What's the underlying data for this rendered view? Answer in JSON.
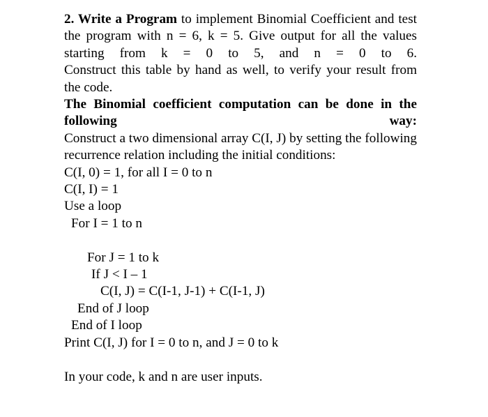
{
  "document": {
    "question_number": "2.",
    "paragraphs": [
      {
        "id": "p1",
        "bold_lead": "2. Write a Program",
        "rest": " to implement Binomial Coefficient and test the program with n = 6, k = 5. Give output for all the values starting from k = 0 to 5, and n = 0 to 6."
      },
      {
        "id": "p2",
        "text": "Construct this table by hand as well, to verify your result from the code."
      },
      {
        "id": "p3",
        "text": "The Binomial coefficient computation can be done in the following way:"
      },
      {
        "id": "p4",
        "text": "Construct a two dimensional array C(I, J) by setting the following recurrence relation including the initial conditions:"
      }
    ],
    "pseudocode": [
      {
        "id": "c1",
        "indent": 0,
        "text": "C(I, 0) = 1, for all I = 0 to n"
      },
      {
        "id": "c2",
        "indent": 0,
        "text": "C(I, I) = 1"
      },
      {
        "id": "c3",
        "indent": 0,
        "text": "Use a loop"
      },
      {
        "id": "c4",
        "indent": 1,
        "text": "For I = 1 to n"
      },
      {
        "id": "c5",
        "indent": 0,
        "text": ""
      },
      {
        "id": "c6",
        "indent": 3,
        "text": "For J = 1 to k"
      },
      {
        "id": "c7",
        "indent": 4,
        "text": "If J < I – 1"
      },
      {
        "id": "c8",
        "indent": 5,
        "text": "C(I, J) = C(I-1, J-1) + C(I-1, J)"
      },
      {
        "id": "c9",
        "indent": 2,
        "text": "End of J loop"
      },
      {
        "id": "c10",
        "indent": 1,
        "text": "End of I loop"
      },
      {
        "id": "c11",
        "indent": 0,
        "text": "Print C(I, J) for I = 0 to n, and J = 0 to k"
      }
    ],
    "closing": {
      "text": "In your code, k and n are user inputs."
    }
  },
  "style": {
    "text_color": "#000000",
    "background_color": "#ffffff"
  }
}
